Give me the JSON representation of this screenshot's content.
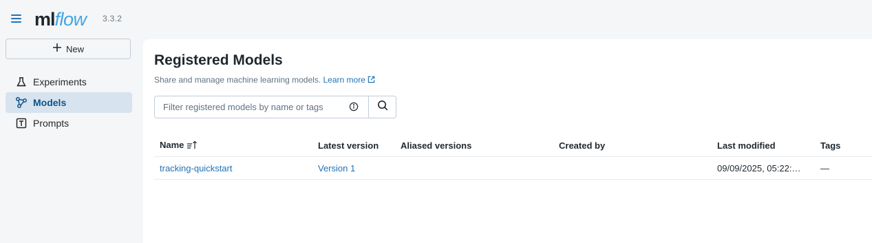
{
  "header": {
    "logo_ml": "ml",
    "logo_flow": "flow",
    "version": "3.3.2"
  },
  "sidebar": {
    "new_label": "New",
    "items": [
      {
        "label": "Experiments",
        "icon": "beaker-icon"
      },
      {
        "label": "Models",
        "icon": "models-icon",
        "active": true
      },
      {
        "label": "Prompts",
        "icon": "text-box-icon"
      }
    ]
  },
  "main": {
    "title": "Registered Models",
    "subtitle": "Share and manage machine learning models.",
    "learn_more": "Learn more",
    "search": {
      "placeholder": "Filter registered models by name or tags"
    },
    "table": {
      "columns": [
        "Name",
        "Latest version",
        "Aliased versions",
        "Created by",
        "Last modified",
        "Tags"
      ],
      "rows": [
        {
          "name": "tracking-quickstart",
          "latest_version": "Version 1",
          "aliased_versions": "",
          "created_by": "",
          "last_modified": "09/09/2025, 05:22:…",
          "tags": "—"
        }
      ]
    }
  },
  "colors": {
    "accent": "#2272b4",
    "logo_flow": "#43a5e3",
    "active_nav_bg": "#d7e3ef",
    "sidebar_bg": "#f5f6f7"
  }
}
